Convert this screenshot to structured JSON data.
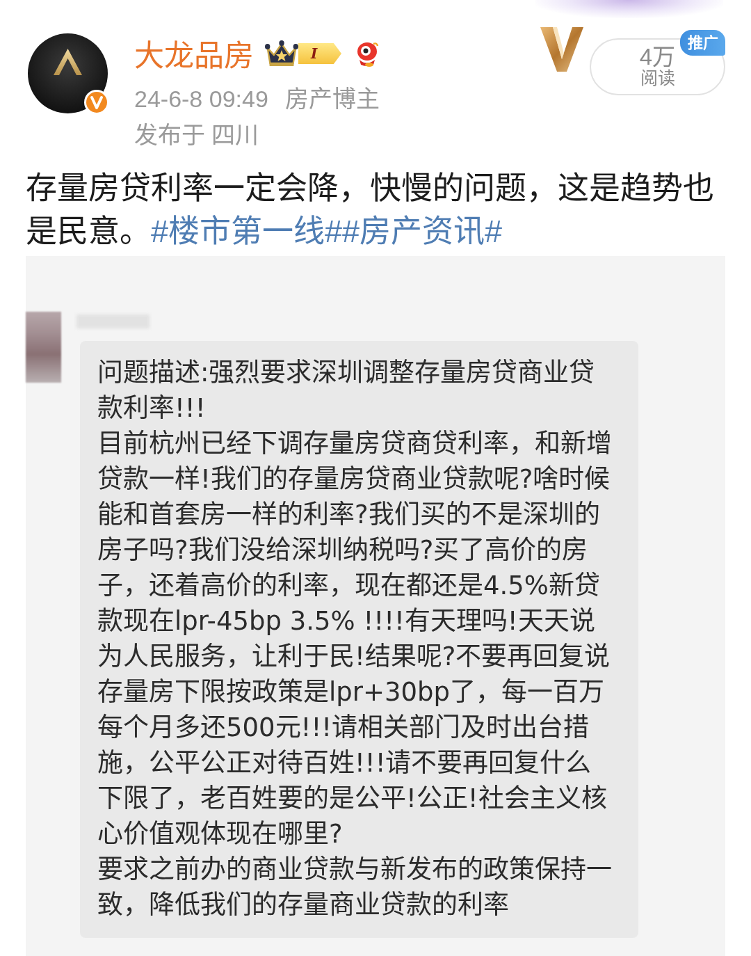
{
  "author": {
    "name": "大龙品房",
    "verified": true,
    "member_badge": {
      "level": "I"
    },
    "time": "24-6-8 09:49",
    "role": "房产博主",
    "location": "发布于 四川"
  },
  "read_count": {
    "value": "4万",
    "label": "阅读",
    "promo_badge": "推广"
  },
  "post": {
    "segments": [
      {
        "kind": "text",
        "text": "存量房贷利率一定会降，快慢的问题，这是趋势也是民意。"
      },
      {
        "kind": "hashtag",
        "text": "#楼市第一线#"
      },
      {
        "kind": "hashtag",
        "text": "#房产资讯#"
      }
    ]
  },
  "image": {
    "message_paragraphs": [
      "问题描述:强烈要求深圳调整存量房贷商业贷款利率!!!",
      "目前杭州已经下调存量房贷商贷利率，和新增贷款一样!我们的存量房贷商业贷款呢?啥时候能和首套房一样的利率?我们买的不是深圳的房子吗?我们没给深圳纳税吗?买了高价的房子，还着高价的利率，现在都还是4.5%新贷款现在lpr-45bp 3.5% !!!!有天理吗!天天说为人民服务，让利于民!结果呢?不要再回复说存量房下限按政策是lpr+30bp了，每一百万每个月多还500元!!!请相关部门及时出台措施，公平公正对待百姓!!!请不要再回复什么下限了，老百姓要的是公平!公正!社会主义核心价值观体现在哪里?",
      "要求之前办的商业贷款与新发布的政策保持一致，降低我们的存量商业贷款的利率"
    ]
  }
}
